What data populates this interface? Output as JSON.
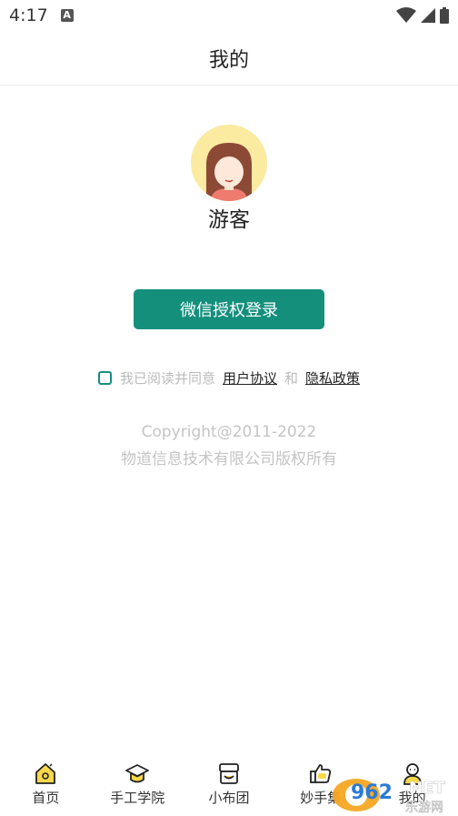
{
  "status_bar": {
    "time": "4:17",
    "app_badge": "A"
  },
  "header": {
    "title": "我的"
  },
  "profile": {
    "username": "游客"
  },
  "login": {
    "button_label": "微信授权登录"
  },
  "agreement": {
    "prefix": "我已阅读并同意",
    "user_agreement": "用户协议",
    "and": "和",
    "privacy_policy": "隐私政策"
  },
  "copyright": {
    "line1": "Copyright@2011-2022",
    "line2": "物道信息技术有限公司版权所有"
  },
  "tabbar": {
    "items": [
      {
        "label": "首页",
        "icon": "home-icon"
      },
      {
        "label": "手工学院",
        "icon": "graduation-cap-icon"
      },
      {
        "label": "小布团",
        "icon": "store-icon"
      },
      {
        "label": "妙手集",
        "icon": "thumbs-up-icon"
      },
      {
        "label": "我的",
        "icon": "profile-icon"
      }
    ]
  },
  "watermark": {
    "text1": "962",
    "text2": "NET",
    "text3": "乐游网"
  },
  "colors": {
    "accent": "#138f7c",
    "icon_yellow": "#f7d84a",
    "avatar_bg": "#fbeba1"
  }
}
